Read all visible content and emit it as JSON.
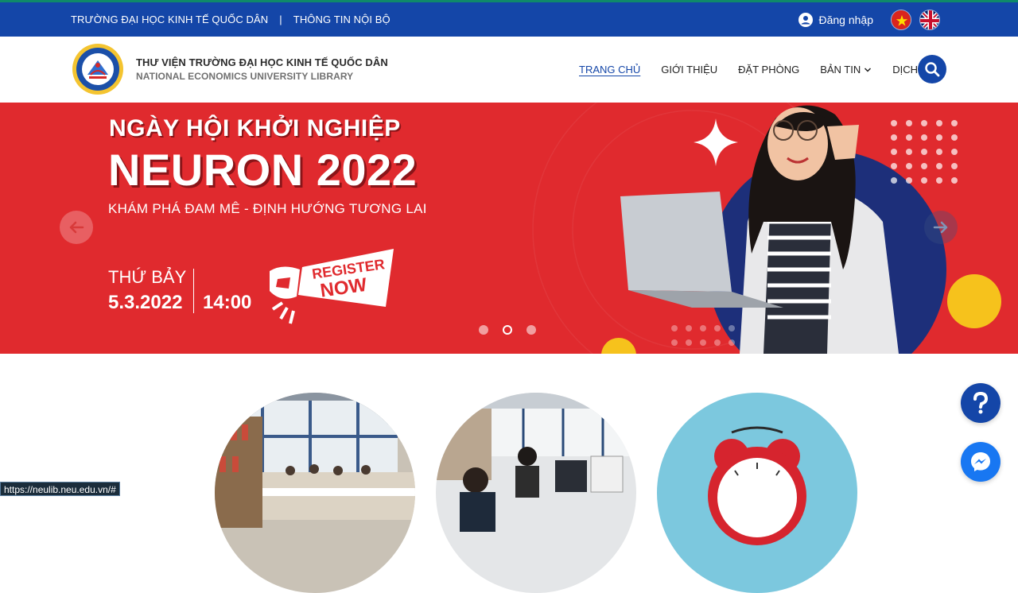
{
  "topbar": {
    "left_links": [
      "TRƯỜNG ĐẠI HỌC KINH TẾ QUỐC DÂN",
      "THÔNG TIN NỘI BỘ"
    ],
    "separator": "|",
    "login_label": "Đăng nhập",
    "bg_color": "#1446a8"
  },
  "header": {
    "title": "THƯ VIỆN TRƯỜNG ĐẠI HỌC KINH TẾ QUỐC DÂN",
    "subtitle": "NATIONAL ECONOMICS UNIVERSITY LIBRARY",
    "nav": [
      "TRANG CHỦ",
      "GIỚI THIỆU",
      "ĐẶT PHÒNG",
      "BẢN TIN",
      "DỊCH VỤ"
    ],
    "active_nav": "TRANG CHỦ"
  },
  "banner": {
    "title_line1": "NGÀY HỘI KHỞI NGHIỆP",
    "title_line2": "NEURON 2022",
    "subtitle": "KHÁM PHÁ ĐAM MÊ - ĐỊNH HƯỚNG TƯƠNG LAI",
    "day": "THỨ BẢY",
    "date": "5.3.2022",
    "time": "14:00",
    "register_line1": "REGISTER",
    "register_line2": "NOW",
    "active_slide": 2,
    "slide_count": 3,
    "bg_color": "#e02a2e"
  },
  "status_url": "https://neulib.neu.edu.vn/#"
}
